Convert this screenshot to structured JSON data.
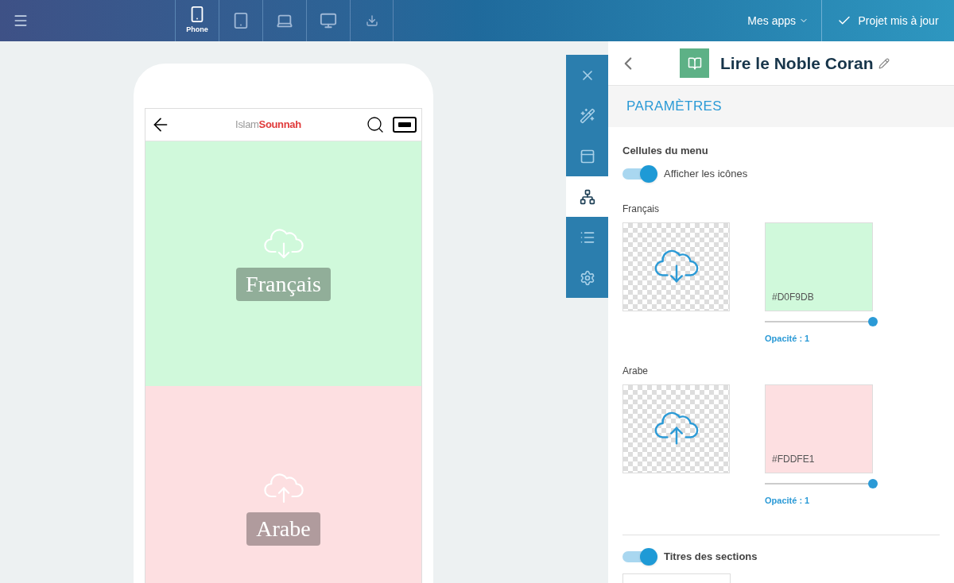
{
  "topbar": {
    "devices": [
      {
        "kind": "phone",
        "label": "Phone",
        "selected": true
      },
      {
        "kind": "tablet",
        "selected": false
      },
      {
        "kind": "laptop",
        "selected": false
      },
      {
        "kind": "desktop",
        "selected": false
      },
      {
        "kind": "download",
        "selected": false
      }
    ],
    "apps_menu": "Mes apps",
    "save_status": "Projet mis à jour"
  },
  "preview": {
    "logo": {
      "first": "Islam",
      "second": "Sounnah"
    },
    "cells": [
      {
        "title": "Français",
        "color": "#d0f9db",
        "kind": "download"
      },
      {
        "title": "Arabe",
        "color": "#fddfe1",
        "kind": "upload"
      }
    ]
  },
  "tools": [
    {
      "kind": "close",
      "selected": false
    },
    {
      "kind": "wand",
      "selected": false
    },
    {
      "kind": "layout",
      "selected": false
    },
    {
      "kind": "tree",
      "selected": true
    },
    {
      "kind": "list",
      "selected": false
    },
    {
      "kind": "settings",
      "selected": false
    }
  ],
  "panel": {
    "title": "Lire le Noble Coran",
    "section": "PARAMÈTRES",
    "group_title": "Cellules du menu",
    "show_icons": {
      "label": "Afficher les icônes",
      "on": true
    },
    "cells": [
      {
        "label": "Français",
        "kind": "download",
        "color": "#d0f9db",
        "hex": "#D0F9DB",
        "level": 1,
        "opacity": "Opacité : 1"
      },
      {
        "label": "Arabe",
        "kind": "upload",
        "color": "#fddfe1",
        "hex": "#FDDFE1",
        "level": 1,
        "opacity": "Opacité : 1"
      }
    ],
    "section_titles": {
      "label": "Titres des sections",
      "on": true
    }
  }
}
